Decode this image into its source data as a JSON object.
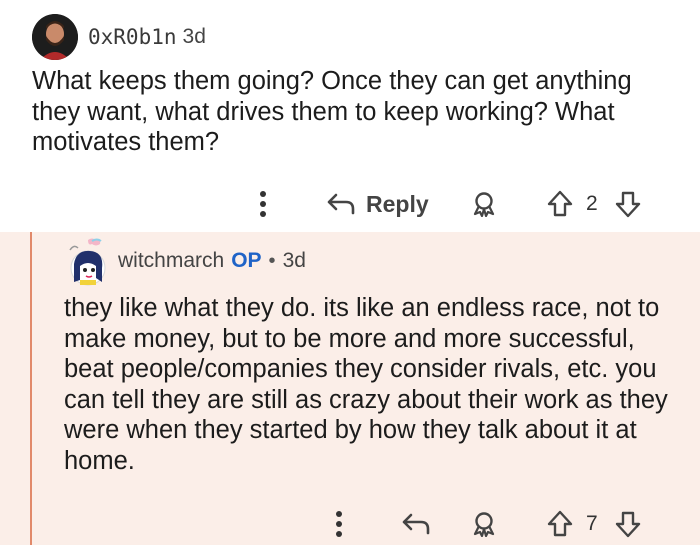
{
  "comments": [
    {
      "username": "0xR0b1n",
      "time": "3d",
      "text": "What keeps them going? Once they can get anything they want, what drives them to keep working? What motivates them?",
      "actions": {
        "reply_label": "Reply",
        "vote_count": "2"
      }
    },
    {
      "username": "witchmarch",
      "op_badge": "OP",
      "separator": "•",
      "time": "3d",
      "text": "they like what they do. its like an endless race, not to make money, but to be more and more successful, beat people/companies they consider rivals, etc. you can tell they are still as crazy about their work as they were when they started by how they talk about it at home.",
      "actions": {
        "vote_count": "7"
      }
    }
  ],
  "colors": {
    "thread_line": "#e1896a",
    "reply_background": "#fbeee8",
    "op_badge": "#1f63c7"
  },
  "icons": [
    "more-icon",
    "reply-icon",
    "award-icon",
    "upvote-icon",
    "downvote-icon"
  ]
}
